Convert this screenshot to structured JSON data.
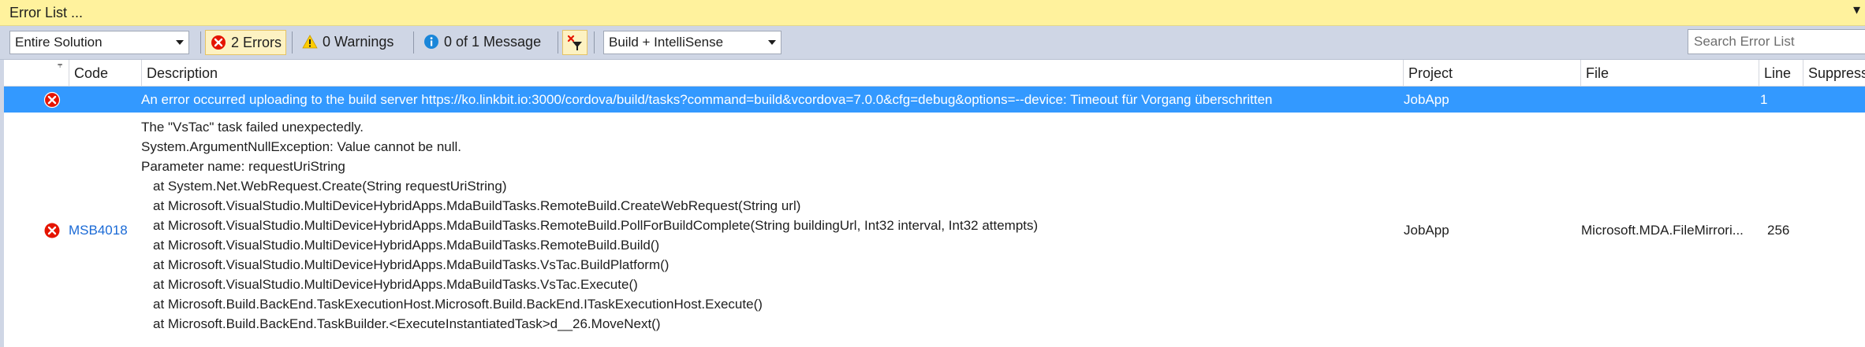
{
  "window": {
    "title": "Error List ..."
  },
  "toolbar": {
    "scope_value": "Entire Solution",
    "errors_label": "2 Errors",
    "warnings_label": "0 Warnings",
    "messages_label": "0 of 1 Message",
    "build_value": "Build + IntelliSense",
    "search_placeholder": "Search Error List"
  },
  "columns": {
    "code": "Code",
    "description": "Description",
    "project": "Project",
    "file": "File",
    "line": "Line",
    "suppression": "Suppressi"
  },
  "rows": [
    {
      "code": "",
      "description": "An error occurred uploading to the build server https://ko.linkbit.io:3000/cordova/build/tasks?command=build&vcordova=7.0.0&cfg=debug&options=--device: Timeout für Vorgang überschritten",
      "project": "JobApp",
      "file": "",
      "line": "1"
    },
    {
      "code": "MSB4018",
      "description_lines": [
        "The \"VsTac\" task failed unexpectedly.",
        "System.ArgumentNullException: Value cannot be null.",
        "Parameter name: requestUriString",
        "at System.Net.WebRequest.Create(String requestUriString)",
        "at Microsoft.VisualStudio.MultiDeviceHybridApps.MdaBuildTasks.RemoteBuild.CreateWebRequest(String url)",
        "at Microsoft.VisualStudio.MultiDeviceHybridApps.MdaBuildTasks.RemoteBuild.PollForBuildComplete(String buildingUrl, Int32 interval, Int32 attempts)",
        "at Microsoft.VisualStudio.MultiDeviceHybridApps.MdaBuildTasks.RemoteBuild.Build()",
        "at Microsoft.VisualStudio.MultiDeviceHybridApps.MdaBuildTasks.VsTac.BuildPlatform()",
        "at Microsoft.VisualStudio.MultiDeviceHybridApps.MdaBuildTasks.VsTac.Execute()",
        "at Microsoft.Build.BackEnd.TaskExecutionHost.Microsoft.Build.BackEnd.ITaskExecutionHost.Execute()",
        "at Microsoft.Build.BackEnd.TaskBuilder.<ExecuteInstantiatedTask>d__26.MoveNext()"
      ],
      "project": "JobApp",
      "file": "Microsoft.MDA.FileMirrori...",
      "line": "256"
    }
  ],
  "icons": {
    "error": "error-circle-icon",
    "warning": "warning-triangle-icon",
    "info": "info-circle-icon",
    "filter": "filter-icon",
    "menu": "chevron-down-icon"
  },
  "colors": {
    "title_bar": "#fff29d",
    "toolbar": "#cfd6e5",
    "selection": "#3399ff",
    "error_red": "#e51400",
    "link_blue": "#1a6ad6",
    "warning_yellow": "#ffcc00",
    "info_blue": "#1a86d9"
  }
}
